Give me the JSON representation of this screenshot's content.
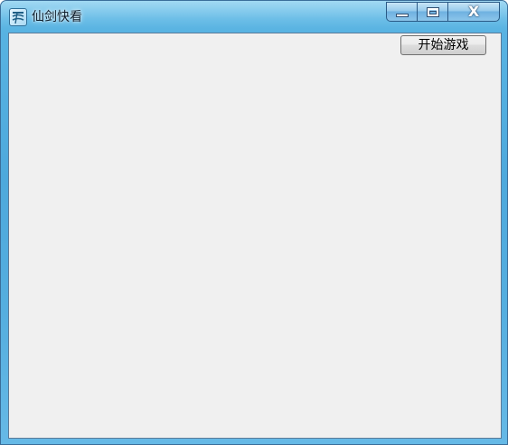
{
  "window": {
    "title": "仙剑快看",
    "controls": {
      "minimize": "minimize",
      "maximize": "maximize",
      "close_label": "X"
    }
  },
  "main": {
    "start_button_label": "开始游戏"
  },
  "colors": {
    "frame": "#55aedf",
    "client_background": "#f0f0f0",
    "button_face": "#e6e6e6"
  },
  "icons": {
    "app": "app-icon",
    "minimize": "minimize-icon",
    "maximize": "maximize-icon",
    "close": "close-icon",
    "resize": "resize-arrow-icon"
  }
}
